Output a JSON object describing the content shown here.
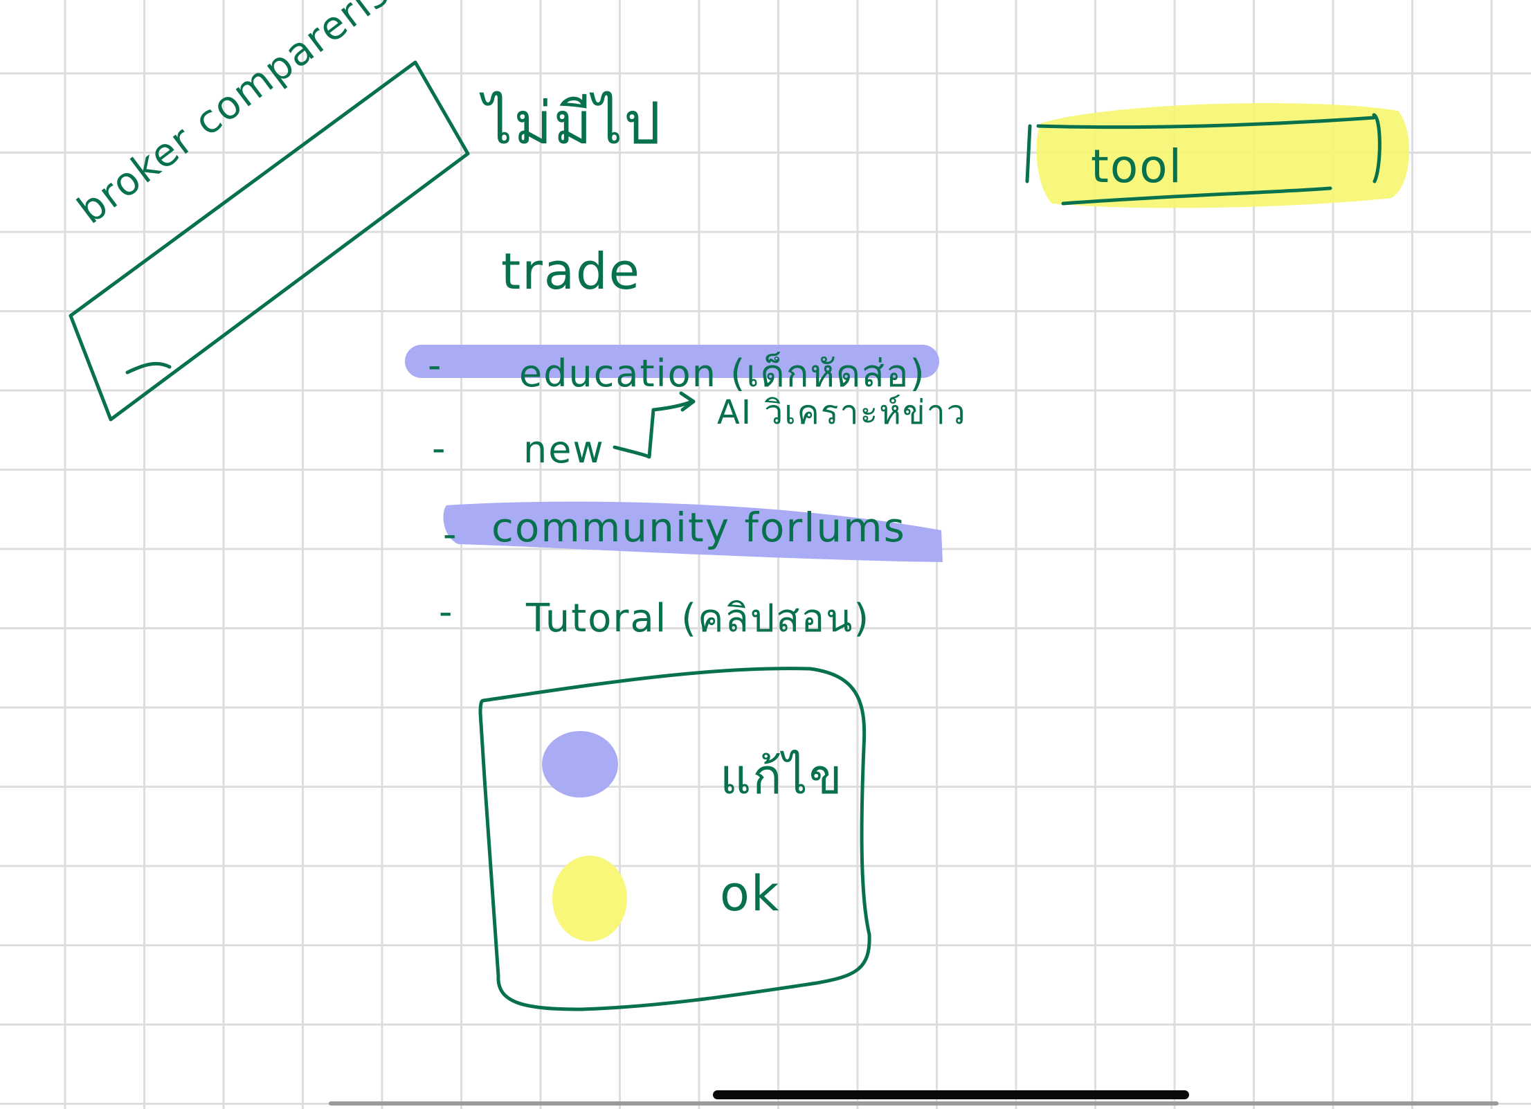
{
  "note": {
    "broker_box_label": "broker comparerison",
    "thai_note_top": "ไม่มีไป",
    "tool_label": "tool",
    "heading": "trade",
    "list": [
      {
        "bullet": "-",
        "label": "education (เด็กหัดส่อ)"
      },
      {
        "bullet": "-",
        "label": "new"
      },
      {
        "bullet": "-",
        "label": "community forlums"
      },
      {
        "bullet": "-",
        "label": "Tutoral (คลิปสอน)"
      }
    ],
    "ai_annotation": "AI วิเคราะห์ข่าว",
    "legend": [
      {
        "label": "แก้ไข",
        "color": "#a9acf5"
      },
      {
        "label": "ok",
        "color": "#f8f77a"
      }
    ]
  },
  "colors": {
    "ink": "#07704d",
    "highlight_blue": "#a9acf5",
    "highlight_yellow": "#f8f77a"
  }
}
